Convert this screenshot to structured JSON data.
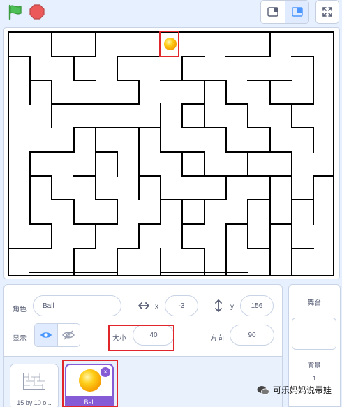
{
  "toolbar": {
    "flag": "green-flag-icon",
    "stop": "stop-icon"
  },
  "sprite_info": {
    "sprite_label": "角色",
    "sprite_name": "Ball",
    "x_label": "x",
    "x_value": "-3",
    "y_label": "y",
    "y_value": "156",
    "show_label": "显示",
    "size_label": "大小",
    "size_value": "40",
    "direction_label": "方向",
    "direction_value": "90"
  },
  "sprites": [
    {
      "name": "15 by 10 o...",
      "selected": false
    },
    {
      "name": "Ball",
      "selected": true
    }
  ],
  "stage_panel": {
    "title": "舞台",
    "backdrops_label": "背景",
    "backdrops_count": "1"
  },
  "watermark": {
    "text": "可乐妈妈说带娃"
  },
  "colors": {
    "accent": "#855cd6",
    "highlight": "#e0262a",
    "flag": "#4cbf56",
    "stop": "#ec5959",
    "ball": "#ffc107"
  }
}
